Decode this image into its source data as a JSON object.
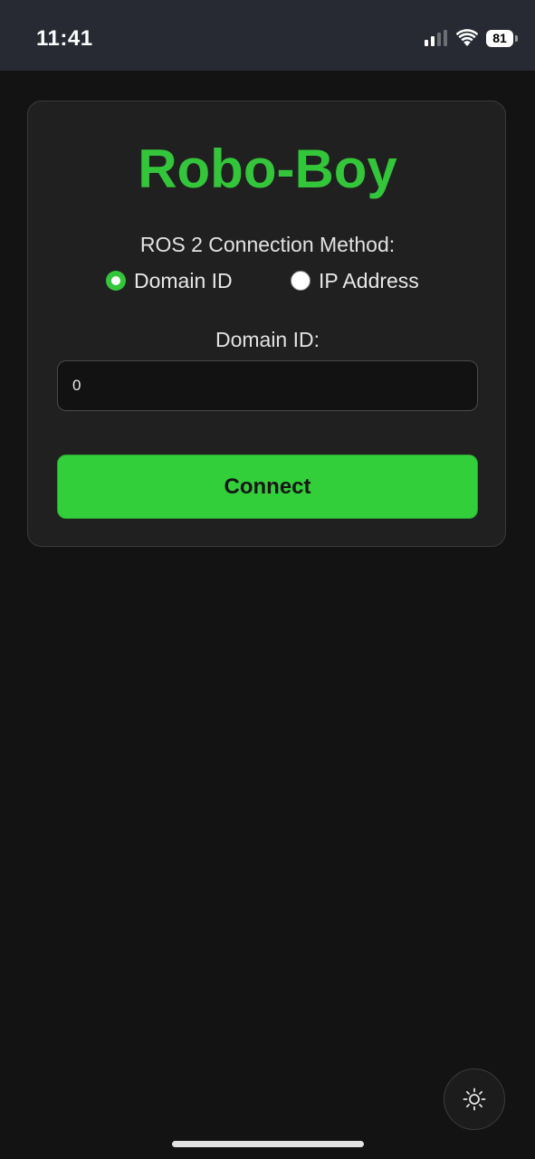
{
  "status_bar": {
    "time": "11:41",
    "battery_level": "81",
    "icons": [
      "signal-icon",
      "wifi-icon",
      "battery-icon"
    ]
  },
  "card": {
    "title": "Robo-Boy",
    "connection_method_label": "ROS 2 Connection Method:",
    "options": [
      {
        "label": "Domain ID",
        "selected": true
      },
      {
        "label": "IP Address",
        "selected": false
      }
    ],
    "domain_id_label": "Domain ID:",
    "domain_id_value": "0",
    "connect_label": "Connect"
  },
  "theme_toggle": {
    "icon": "sun-icon"
  },
  "colors": {
    "accent": "#33c53a",
    "background": "#131313",
    "card": "#202020",
    "status_bar": "#272a32"
  }
}
